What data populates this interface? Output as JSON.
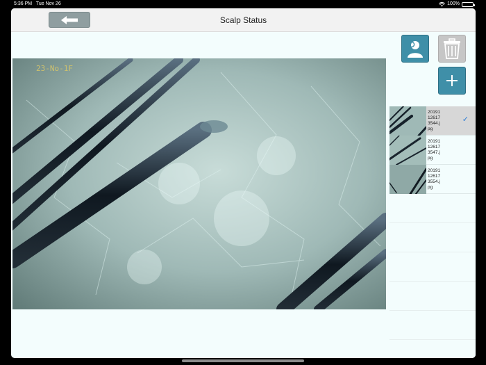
{
  "status_bar": {
    "time": "5:36 PM",
    "date": "Tue Nov 26",
    "battery": "100%",
    "battery_level": 1.0
  },
  "nav": {
    "title": "Scalp Status",
    "back_icon": "arrow-left-icon"
  },
  "viewer": {
    "overlay_date": "23-No-1F"
  },
  "toolbar": {
    "search_user_icon": "user-search-icon",
    "delete_icon": "trash-icon",
    "add_icon": "plus-icon"
  },
  "files": [
    {
      "name": "20191 12617 3544.j pg",
      "lines": [
        "20191",
        "12617",
        "3544.j",
        "pg"
      ],
      "selected": true
    },
    {
      "name": "20191 12617 3547.j pg",
      "lines": [
        "20191",
        "12617",
        "3547.j",
        "pg"
      ],
      "selected": false
    },
    {
      "name": "20191 12617 3554.j pg",
      "lines": [
        "20191",
        "12617",
        "3554.j",
        "pg"
      ],
      "selected": false
    }
  ],
  "colors": {
    "accent": "#3f8fa8",
    "check": "#2a7bd6",
    "background": "#f3fdfd"
  }
}
